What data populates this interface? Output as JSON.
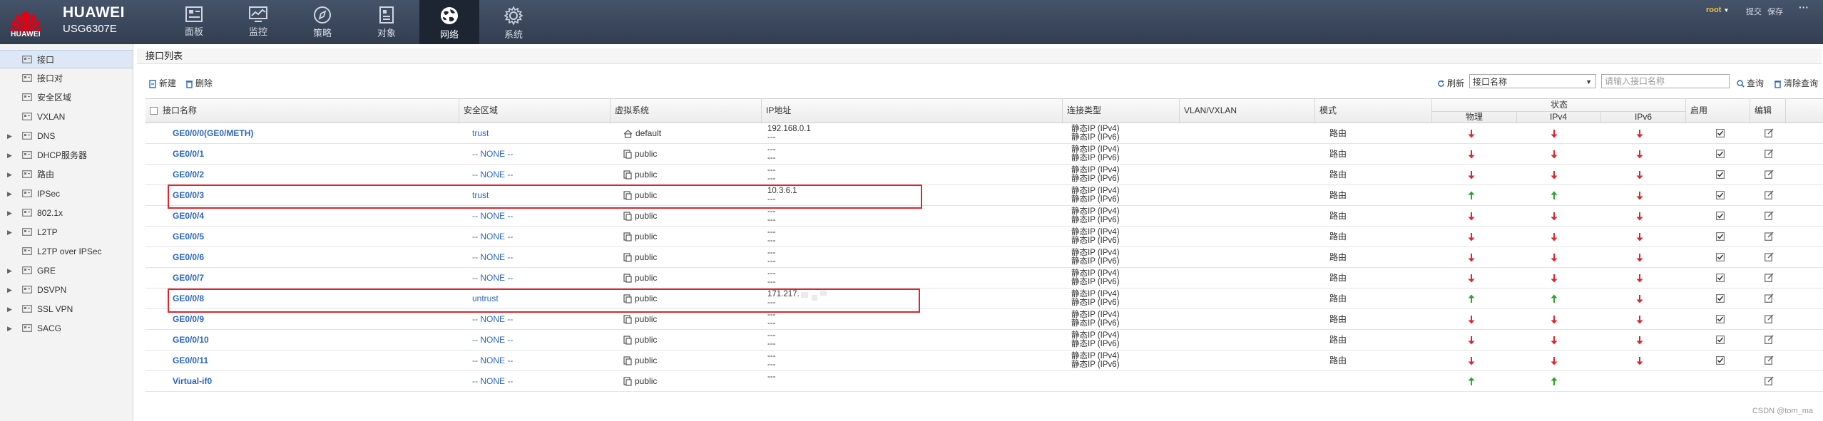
{
  "header": {
    "brand": "HUAWEI",
    "model": "USG6307E",
    "logo_text": "HUAWEI",
    "nav": [
      {
        "label": "面板",
        "icon": "dashboard-icon"
      },
      {
        "label": "监控",
        "icon": "monitor-icon"
      },
      {
        "label": "策略",
        "icon": "compass-icon"
      },
      {
        "label": "对象",
        "icon": "object-icon"
      },
      {
        "label": "网络",
        "icon": "globe-icon",
        "active": true
      },
      {
        "label": "系统",
        "icon": "gear-icon"
      }
    ],
    "user": "root",
    "submit": "提交",
    "save": "保存",
    "more": "···"
  },
  "sidebar": {
    "items": [
      {
        "label": "接口",
        "icon": "interface-icon",
        "active": true
      },
      {
        "label": "接口对",
        "icon": "interface-pair-icon"
      },
      {
        "label": "安全区域",
        "icon": "security-zone-icon"
      },
      {
        "label": "VXLAN",
        "icon": "vxlan-icon"
      },
      {
        "label": "DNS",
        "icon": "dns-icon",
        "expandable": true
      },
      {
        "label": "DHCP服务器",
        "icon": "dhcp-icon",
        "expandable": true
      },
      {
        "label": "路由",
        "icon": "route-icon",
        "expandable": true
      },
      {
        "label": "IPSec",
        "icon": "ipsec-icon",
        "expandable": true
      },
      {
        "label": "802.1x",
        "icon": "dot1x-icon",
        "expandable": true
      },
      {
        "label": "L2TP",
        "icon": "l2tp-icon",
        "expandable": true
      },
      {
        "label": "L2TP over IPSec",
        "icon": "l2tp-ipsec-icon"
      },
      {
        "label": "GRE",
        "icon": "gre-icon",
        "expandable": true
      },
      {
        "label": "DSVPN",
        "icon": "dsvpn-icon",
        "expandable": true
      },
      {
        "label": "SSL VPN",
        "icon": "sslvpn-icon",
        "expandable": true
      },
      {
        "label": "SACG",
        "icon": "sacg-icon",
        "expandable": true
      }
    ]
  },
  "panel": {
    "title": "接口列表",
    "new_label": "新建",
    "delete_label": "删除",
    "refresh_label": "刷新",
    "search_field": "接口名称",
    "search_placeholder": "请输入接口名称",
    "query_label": "查询",
    "clear_label": "清除查询"
  },
  "table": {
    "columns": {
      "name": "接口名称",
      "zone": "安全区域",
      "vsys": "虚拟系统",
      "ip": "IP地址",
      "conn": "连接类型",
      "vlan": "VLAN/VXLAN",
      "mode": "模式",
      "state": "状态",
      "phys": "物理",
      "ipv4": "IPv4",
      "ipv6": "IPv6",
      "enable": "启用",
      "edit": "编辑"
    },
    "rows": [
      {
        "name": "GE0/0/0(GE0/METH)",
        "zone": "trust",
        "vsys": "default",
        "ip1": "192.168.0.1",
        "ip2": "---",
        "conn1": "静态IP (IPv4)",
        "conn2": "静态IP (IPv6)",
        "mode": "路由",
        "phys": "down",
        "ipv4": "down",
        "ipv6": "down",
        "enabled": true
      },
      {
        "name": "GE0/0/1",
        "zone": "-- NONE --",
        "vsys": "public",
        "ip1": "---",
        "ip2": "---",
        "conn1": "静态IP (IPv4)",
        "conn2": "静态IP (IPv6)",
        "mode": "路由",
        "phys": "down",
        "ipv4": "down",
        "ipv6": "down",
        "enabled": true
      },
      {
        "name": "GE0/0/2",
        "zone": "-- NONE --",
        "vsys": "public",
        "ip1": "---",
        "ip2": "---",
        "conn1": "静态IP (IPv4)",
        "conn2": "静态IP (IPv6)",
        "mode": "路由",
        "phys": "down",
        "ipv4": "down",
        "ipv6": "down",
        "enabled": true
      },
      {
        "name": "GE0/0/3",
        "zone": "trust",
        "vsys": "public",
        "ip1": "10.3.6.1",
        "ip2": "---",
        "conn1": "静态IP (IPv4)",
        "conn2": "静态IP (IPv6)",
        "mode": "路由",
        "phys": "up",
        "ipv4": "up",
        "ipv6": "down",
        "enabled": true
      },
      {
        "name": "GE0/0/4",
        "zone": "-- NONE --",
        "vsys": "public",
        "ip1": "---",
        "ip2": "---",
        "conn1": "静态IP (IPv4)",
        "conn2": "静态IP (IPv6)",
        "mode": "路由",
        "phys": "down",
        "ipv4": "down",
        "ipv6": "down",
        "enabled": true
      },
      {
        "name": "GE0/0/5",
        "zone": "-- NONE --",
        "vsys": "public",
        "ip1": "---",
        "ip2": "---",
        "conn1": "静态IP (IPv4)",
        "conn2": "静态IP (IPv6)",
        "mode": "路由",
        "phys": "down",
        "ipv4": "down",
        "ipv6": "down",
        "enabled": true
      },
      {
        "name": "GE0/0/6",
        "zone": "-- NONE --",
        "vsys": "public",
        "ip1": "---",
        "ip2": "---",
        "conn1": "静态IP (IPv4)",
        "conn2": "静态IP (IPv6)",
        "mode": "路由",
        "phys": "down",
        "ipv4": "down",
        "ipv6": "down",
        "enabled": true
      },
      {
        "name": "GE0/0/7",
        "zone": "-- NONE --",
        "vsys": "public",
        "ip1": "---",
        "ip2": "---",
        "conn1": "静态IP (IPv4)",
        "conn2": "静态IP (IPv6)",
        "mode": "路由",
        "phys": "down",
        "ipv4": "down",
        "ipv6": "down",
        "enabled": true
      },
      {
        "name": "GE0/0/8",
        "zone": "untrust",
        "vsys": "public",
        "ip1": "171.217.",
        "ip2": "---",
        "conn1": "静态IP (IPv4)",
        "conn2": "静态IP (IPv6)",
        "mode": "路由",
        "phys": "up",
        "ipv4": "up",
        "ipv6": "down",
        "enabled": true
      },
      {
        "name": "GE0/0/9",
        "zone": "-- NONE --",
        "vsys": "public",
        "ip1": "---",
        "ip2": "---",
        "conn1": "静态IP (IPv4)",
        "conn2": "静态IP (IPv6)",
        "mode": "路由",
        "phys": "down",
        "ipv4": "down",
        "ipv6": "down",
        "enabled": true
      },
      {
        "name": "GE0/0/10",
        "zone": "-- NONE --",
        "vsys": "public",
        "ip1": "---",
        "ip2": "---",
        "conn1": "静态IP (IPv4)",
        "conn2": "静态IP (IPv6)",
        "mode": "路由",
        "phys": "down",
        "ipv4": "down",
        "ipv6": "down",
        "enabled": true
      },
      {
        "name": "GE0/0/11",
        "zone": "-- NONE --",
        "vsys": "public",
        "ip1": "---",
        "ip2": "---",
        "conn1": "静态IP (IPv4)",
        "conn2": "静态IP (IPv6)",
        "mode": "路由",
        "phys": "down",
        "ipv4": "down",
        "ipv6": "down",
        "enabled": true
      },
      {
        "name": "Virtual-if0",
        "zone": "-- NONE --",
        "vsys": "public",
        "ip1": "---",
        "ip2": "",
        "conn1": "",
        "conn2": "",
        "mode": "",
        "phys": "up",
        "ipv4": "up",
        "ipv6": "none",
        "enabled": false
      }
    ]
  },
  "colors": {
    "up": "#2aa52a",
    "down": "#e0242a",
    "link": "#2a66c3",
    "highlight": "#e0242a"
  },
  "watermark": "CSDN @tom_ma"
}
